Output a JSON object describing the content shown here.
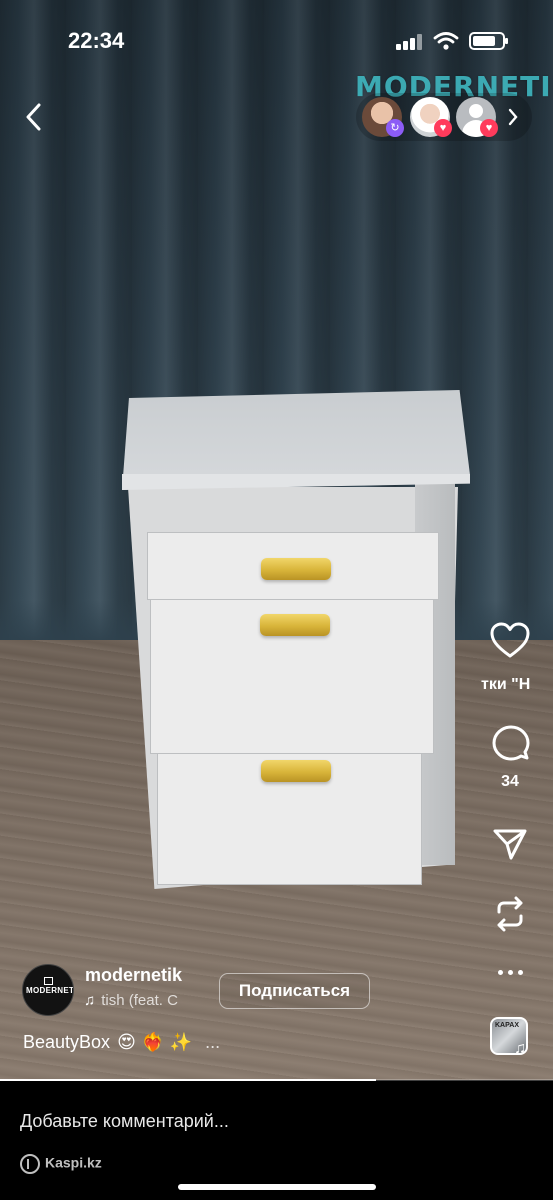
{
  "status_bar": {
    "time": "22:34"
  },
  "brand_watermark": "MODERNETIK",
  "actions": {
    "like_label": "тки \"Н",
    "comment_count": "34"
  },
  "author": {
    "avatar_text": "MODERNETIK",
    "username": "modernetik",
    "audio": "tish (feat. C"
  },
  "follow_label": "Подписаться",
  "caption": {
    "text": "BeautyBox",
    "emojis": "😍 ❤️‍🔥 ✨",
    "more": "..."
  },
  "audio_thumb_text": "KAPAX",
  "comment_placeholder": "Добавьте комментарий...",
  "watermark_source": "Kaspi.kz",
  "video_progress": 0.68,
  "icons": [
    "back-chevron-icon",
    "signal-icon",
    "wifi-icon",
    "battery-icon",
    "heart-icon",
    "comment-icon",
    "share-icon",
    "remix-icon",
    "more-icon",
    "music-note-icon"
  ],
  "colors": {
    "accent_pink": "#ff3b5c",
    "accent_purple": "#8c5cf6",
    "brand_teal": "#3fb7c0",
    "handle_gold": "#d8b43a"
  }
}
